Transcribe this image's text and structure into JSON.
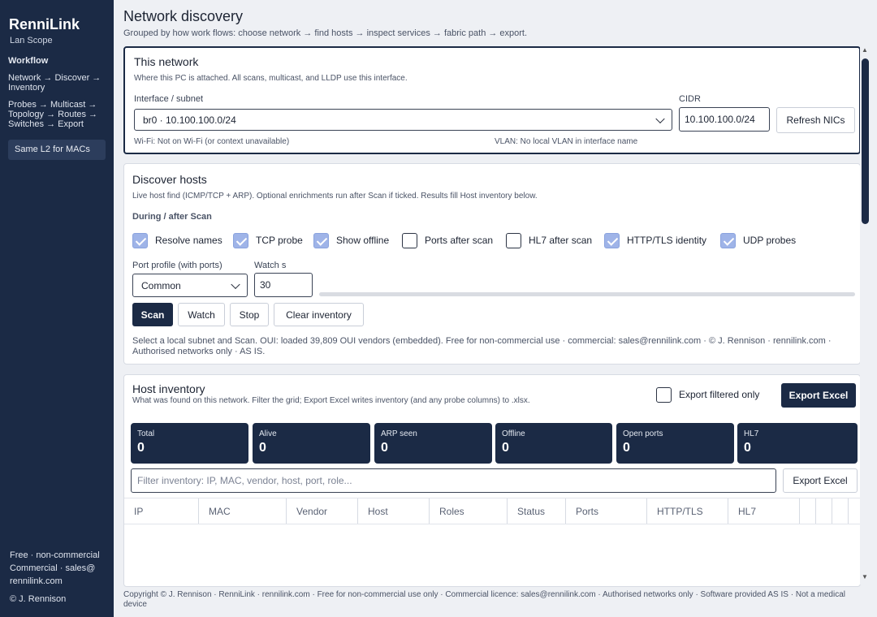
{
  "app": {
    "brand": "RenniLink",
    "subtitle": "Lan Scope"
  },
  "sidebar": {
    "workflow_heading": "Workflow",
    "workflow_line1": "Network → Discover → Inventory",
    "workflow_line2": "Probes → Multicast → Topology → Routes → Switches → Export",
    "button_label": "Same L2 for MACs",
    "footer_line1": "Free · non-commercial Commercial · sales@ rennilink.com",
    "footer_line2": "© J. Rennison"
  },
  "header": {
    "title": "Network discovery",
    "subtitle": "Grouped by how work flows: choose network → find hosts → inspect services → fabric path → export."
  },
  "network": {
    "heading": "This network",
    "description": "Where this PC is attached. All scans, multicast, and LLDP use this interface.",
    "interface_label": "Interface / subnet",
    "interface_value": "br0 · 10.100.100.0/24",
    "cidr_label": "CIDR",
    "cidr_value": "10.100.100.0/24",
    "refresh_label": "Refresh NICs",
    "wifi_status": "Wi-Fi: Not on Wi-Fi (or context unavailable)",
    "vlan_status": "VLAN: No local VLAN in interface name"
  },
  "discover": {
    "heading": "Discover hosts",
    "description": "Live host find (ICMP/TCP + ARP). Optional enrichments run after Scan if ticked. Results fill Host inventory below.",
    "options_heading": "During / after Scan",
    "options": [
      {
        "label": "Resolve names",
        "checked": true
      },
      {
        "label": "TCP probe",
        "checked": true
      },
      {
        "label": "Show offline",
        "checked": true
      },
      {
        "label": "Ports after scan",
        "checked": false
      },
      {
        "label": "HL7 after scan",
        "checked": false
      },
      {
        "label": "HTTP/TLS identity",
        "checked": true
      },
      {
        "label": "UDP probes",
        "checked": true
      }
    ],
    "port_profile_label": "Port profile (with ports)",
    "port_profile_value": "Common",
    "watch_label": "Watch s",
    "watch_value": "30",
    "progress": 0,
    "scan_label": "Scan",
    "watch_button_label": "Watch",
    "stop_label": "Stop",
    "clear_label": "Clear inventory",
    "status_text": "Select a local subnet and Scan. OUI: loaded 39,809 OUI vendors (embedded). Free for non-commercial use · commercial: sales@rennilink.com · © J. Rennison · rennilink.com · Authorised networks only · AS IS."
  },
  "inventory": {
    "heading": "Host inventory",
    "description": "What was found on this network. Filter the grid; Export Excel writes inventory (and any probe columns) to .xlsx.",
    "export_filtered_label": "Export filtered only",
    "export_filtered_checked": false,
    "export_excel_primary": "Export Excel",
    "export_excel_secondary": "Export Excel",
    "filter_placeholder": "Filter inventory: IP, MAC, vendor, host, port, role...",
    "stats": [
      {
        "label": "Total",
        "value": "0"
      },
      {
        "label": "Alive",
        "value": "0"
      },
      {
        "label": "ARP seen",
        "value": "0"
      },
      {
        "label": "Offline",
        "value": "0"
      },
      {
        "label": "Open ports",
        "value": "0"
      },
      {
        "label": "HL7",
        "value": "0"
      }
    ],
    "columns": [
      "IP",
      "MAC",
      "Vendor",
      "Host",
      "Roles",
      "Status",
      "Ports",
      "HTTP/TLS",
      "HL7",
      "",
      "",
      ""
    ]
  },
  "footer": {
    "text": "Copyright © J. Rennison · RenniLink · rennilink.com · Free for non-commercial use only · Commercial licence: sales@rennilink.com · Authorised networks only · Software provided AS IS · Not a medical device"
  },
  "colors": {
    "sidebar_bg": "#1b2a45",
    "accent_dark": "#1b2a45",
    "checkbox_on": "#9fb4e8",
    "page_bg": "#eef0f4"
  }
}
